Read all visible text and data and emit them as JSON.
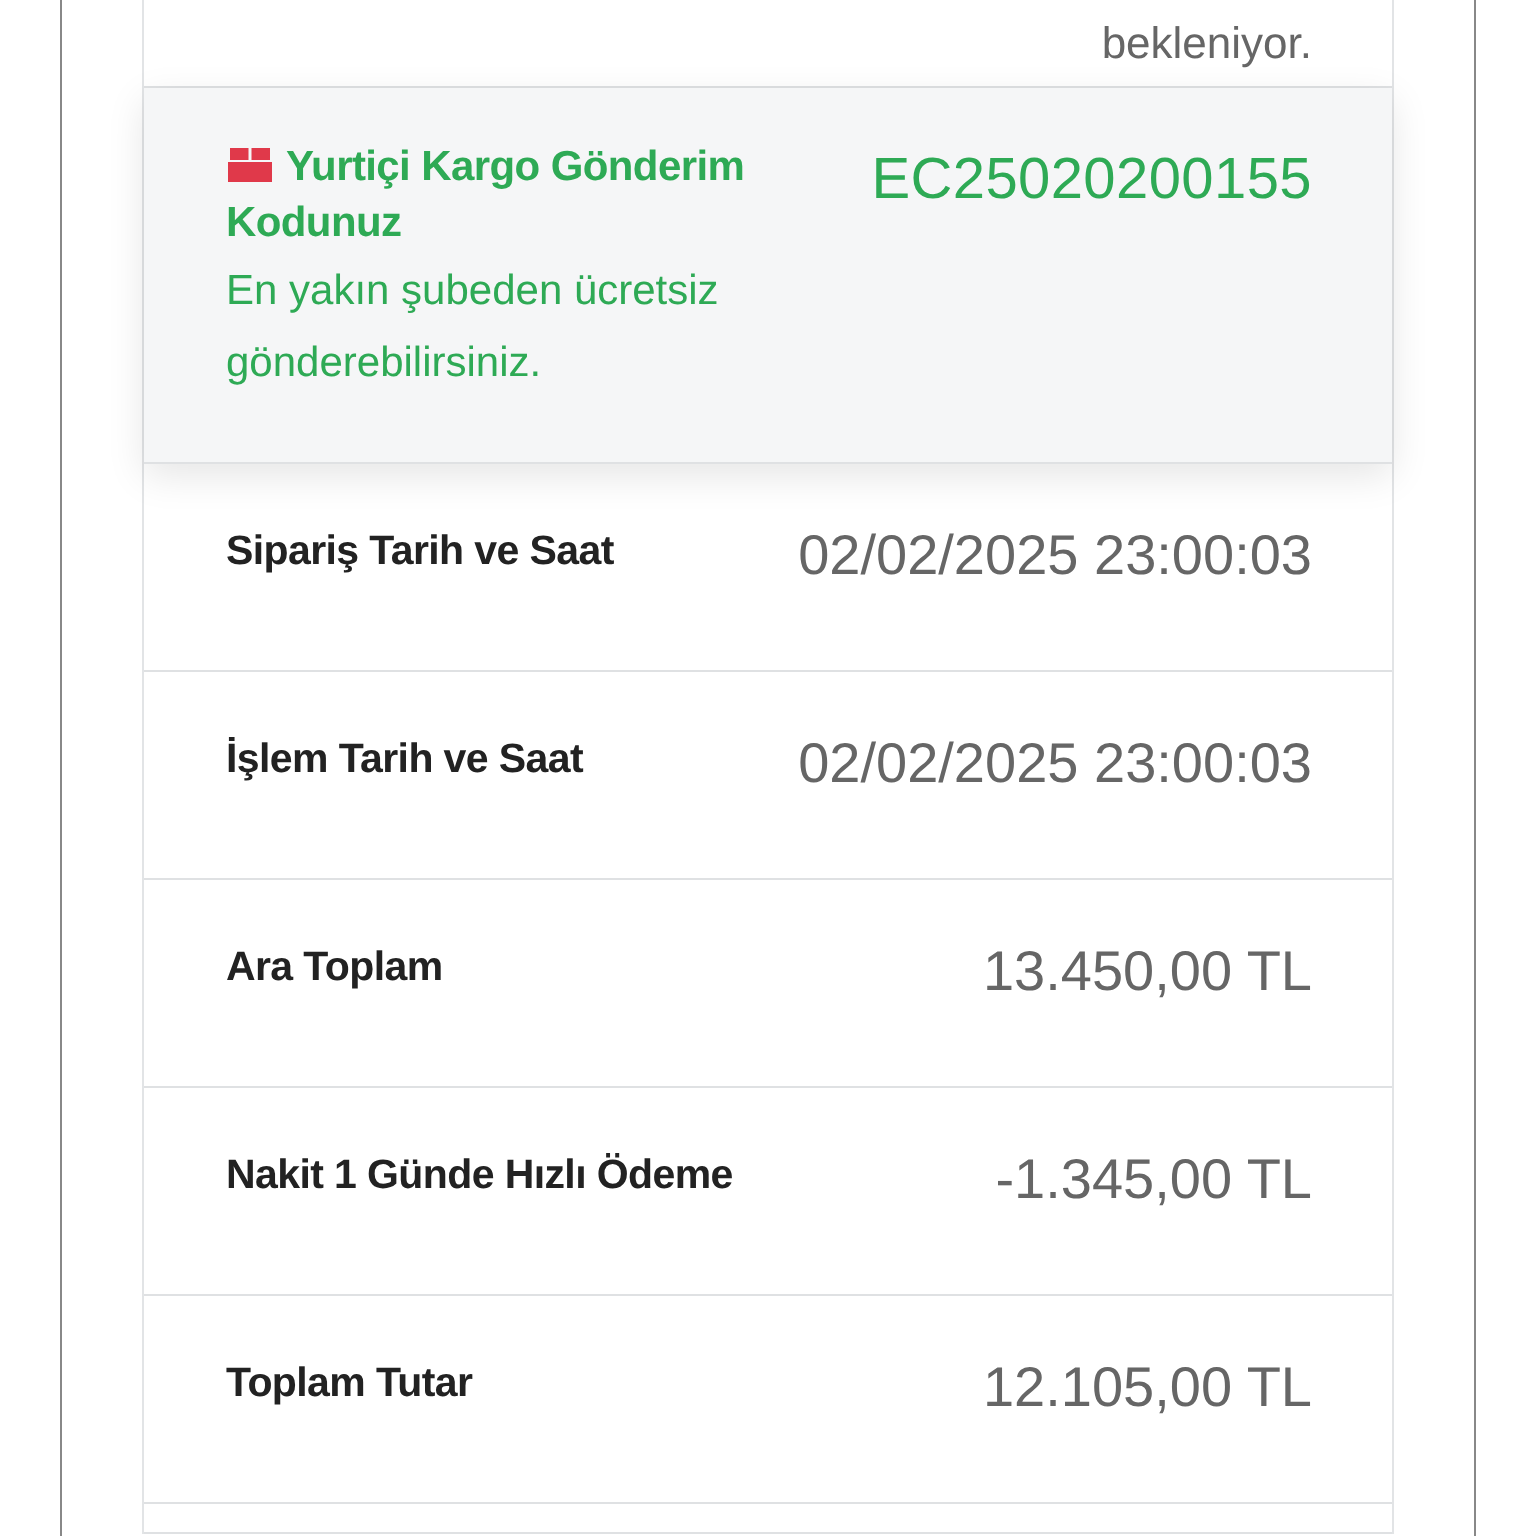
{
  "status_text": "bekleniyor.",
  "shipping": {
    "title": "Yurtiçi Kargo Gönderim Kodunuz",
    "code": "EC25020200155",
    "note": "En yakın şubeden ücretsiz gönderebilirsiniz."
  },
  "details": [
    {
      "label": "Sipariş Tarih ve Saat",
      "value": "02/02/2025 23:00:03"
    },
    {
      "label": "İşlem Tarih ve Saat",
      "value": "02/02/2025 23:00:03"
    },
    {
      "label": "Ara Toplam",
      "value": "13.450,00 TL"
    },
    {
      "label": "Nakit 1 Günde Hızlı Ödeme",
      "value": "-1.345,00 TL"
    },
    {
      "label": "Toplam Tutar",
      "value": "12.105,00 TL"
    }
  ]
}
